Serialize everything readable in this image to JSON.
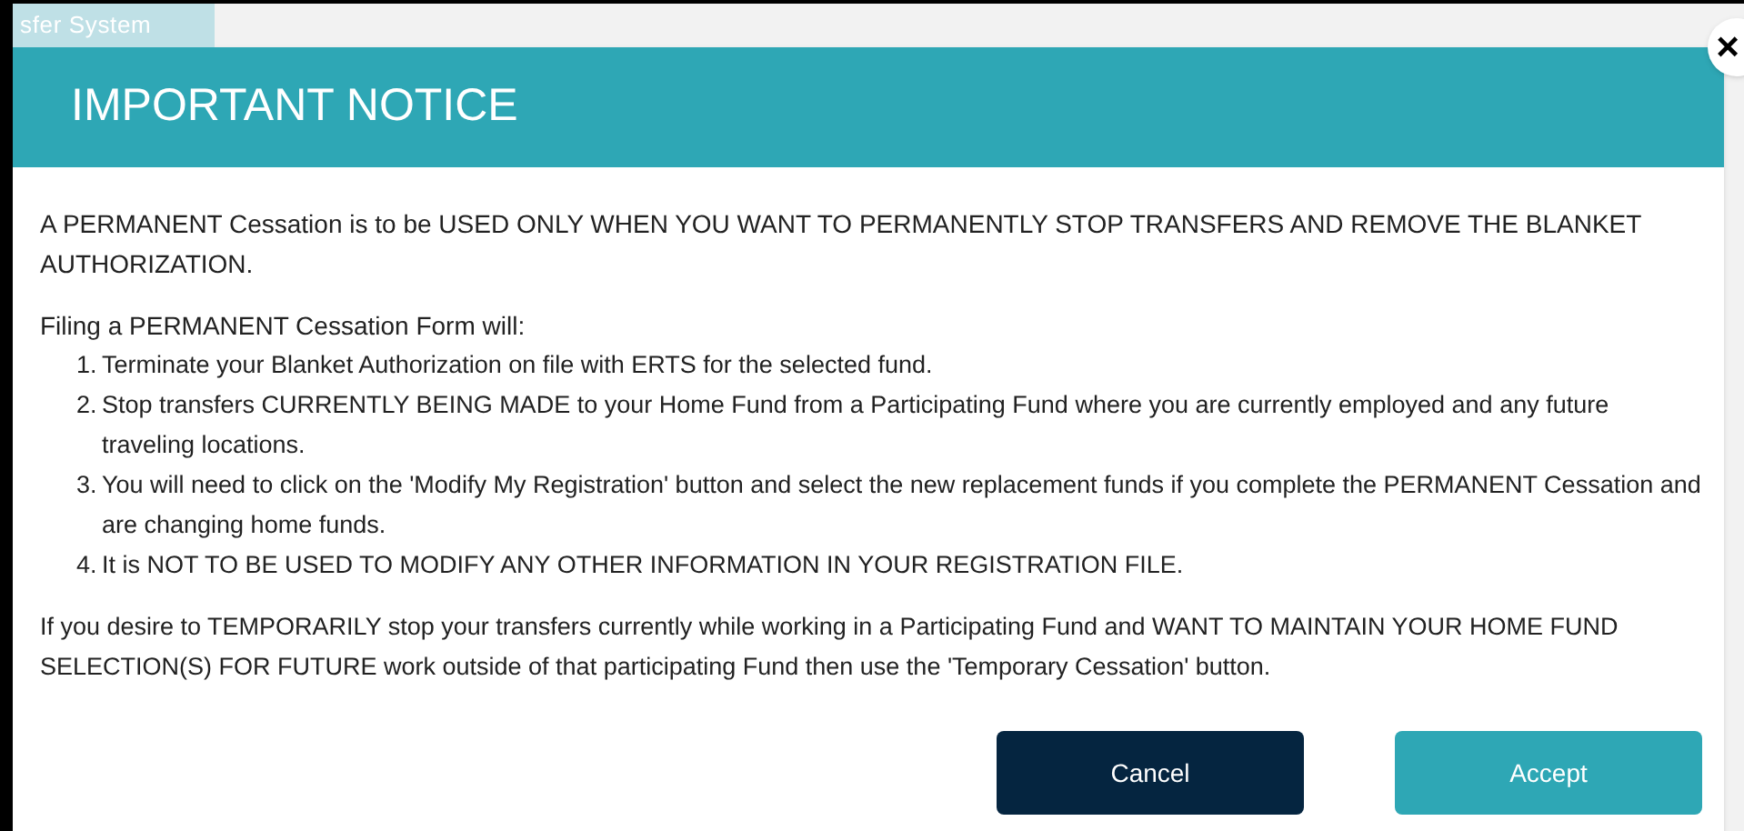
{
  "background": {
    "app_title": "sfer System"
  },
  "dialog": {
    "title": "IMPORTANT NOTICE",
    "intro": "A PERMANENT Cessation is to be USED ONLY WHEN YOU WANT TO PERMANENTLY STOP TRANSFERS AND REMOVE THE BLANKET AUTHORIZATION.",
    "list_heading": "Filing a PERMANENT Cessation Form will:",
    "items": [
      {
        "number": "1.",
        "text": "Terminate your Blanket Authorization on file with ERTS for the selected fund."
      },
      {
        "number": "2.",
        "text": "Stop transfers CURRENTLY BEING MADE to your Home Fund from a Participating Fund where you are currently employed and any future traveling locations."
      },
      {
        "number": "3.",
        "text": "You will need to click on the 'Modify My Registration' button and select the new replacement funds if you complete the PERMANENT Cessation and are changing home funds."
      },
      {
        "number": "4.",
        "text": "It is NOT TO BE USED TO MODIFY ANY OTHER INFORMATION IN YOUR REGISTRATION FILE."
      }
    ],
    "footer_text": "If you desire to TEMPORARILY stop your transfers currently while working in a Participating Fund and WANT TO MAINTAIN YOUR HOME FUND SELECTION(S) FOR FUTURE work outside of that participating Fund then use the 'Temporary Cessation' button.",
    "close": "×",
    "buttons": [
      {
        "label": "Cancel",
        "kind": "dark"
      },
      {
        "label": "Accept",
        "kind": "primary"
      }
    ]
  }
}
